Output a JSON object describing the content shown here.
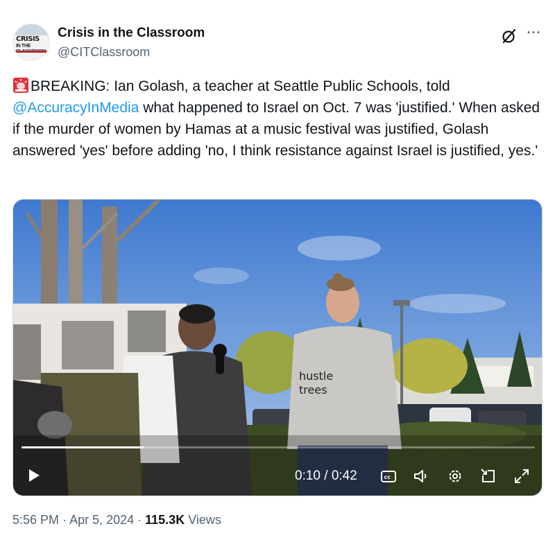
{
  "author": {
    "name": "Crisis in the Classroom",
    "handle": "@CITClassroom",
    "avatar_text_main": "CRISIS",
    "avatar_text_sub": "IN THE CLASSROOM"
  },
  "tweet": {
    "emoji": "siren-icon",
    "text_before_mention": "BREAKING: Ian Golash, a teacher at Seattle Public Schools, told",
    "mention": "@AccuracyInMedia",
    "text_after_mention": " what happened to Israel on Oct. 7 was 'justified.' When asked if the murder of women by Hamas at a music festival was justified, Golash answered 'yes' before adding 'no, I think resistance against Israel is justified, yes.'"
  },
  "video": {
    "time_display": "0:10 / 0:42",
    "progress_fraction": 0.238,
    "hoodie_text_line1": "hustle",
    "hoodie_text_line2": "trees",
    "controls": [
      "play-icon",
      "captions-icon",
      "volume-icon",
      "settings-icon",
      "pip-icon",
      "fullscreen-icon"
    ]
  },
  "meta": {
    "time": "5:56 PM",
    "sep1": " · ",
    "date": "Apr 5, 2024",
    "sep2": " · ",
    "views_count": "115.3K",
    "views_label": " Views"
  },
  "colors": {
    "link": "#1d9bf0",
    "secondary_text": "#536471",
    "primary_text": "#0f1419"
  }
}
